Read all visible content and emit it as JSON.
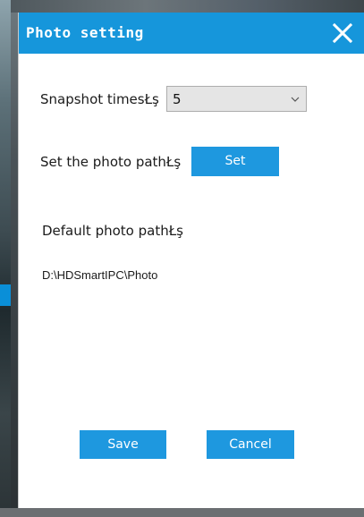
{
  "dialog": {
    "title": "Photo setting",
    "snapshot": {
      "label": "Snapshot timesŁş",
      "selected": "5"
    },
    "photo_path": {
      "label": "Set the photo pathŁş",
      "set_button": "Set"
    },
    "default_path": {
      "label": "Default photo pathŁş",
      "value": "D:\\HDSmartIPC\\Photo"
    },
    "buttons": {
      "save": "Save",
      "cancel": "Cancel"
    }
  },
  "icons": {
    "close": "close-icon",
    "dropdown": "chevron-down-icon"
  },
  "colors": {
    "accent": "#1696db",
    "button": "#1e98df"
  }
}
